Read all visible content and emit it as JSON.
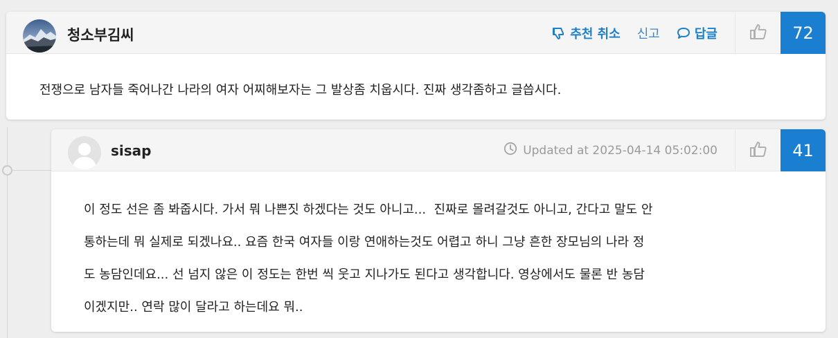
{
  "comments": [
    {
      "username": "청소부김씨",
      "actions": {
        "cancel_recommend": "추천 취소",
        "report": "신고",
        "reply": "답글"
      },
      "score": "72",
      "text": "전쟁으로 남자들 죽어나간 나라의 여자 어찌해보자는 그 발상좀 치웁시다. 진짜 생각좀하고 글씁시다."
    },
    {
      "username": "sisap",
      "updated": "Updated at 2025-04-14 05:02:00",
      "score": "41",
      "text_lines": [
        "이 정도 선은 좀 봐줍시다. 가서 뭐 나쁜짓 하겠다는 것도 아니고...  진짜로 몰려갈것도 아니고, 간다고 말도 안",
        "통하는데 뭐 실제로 되겠나요.. 요즘 한국 여자들 이랑 연애하는것도 어렵고 하니 그냥 흔한 장모님의 나라 정",
        "도 농담인데요... 선 넘지 않은 이 정도는 한번 씩 웃고 지나가도 된다고 생각합니다. 영상에서도 물론 반 농담",
        "이겠지만.. 연락 많이 달라고 하는데요 뭐.."
      ]
    }
  ],
  "icons": {
    "cancel_recommend": "thumbs-down-icon",
    "reply": "speech-bubble-icon",
    "updated": "clock-icon",
    "like": "thumbs-up-icon"
  },
  "colors": {
    "accent": "#1a7fd0",
    "action_text": "#1f7fc4",
    "page_bg": "#eeeeee",
    "header_bg": "#f5f5f5"
  }
}
